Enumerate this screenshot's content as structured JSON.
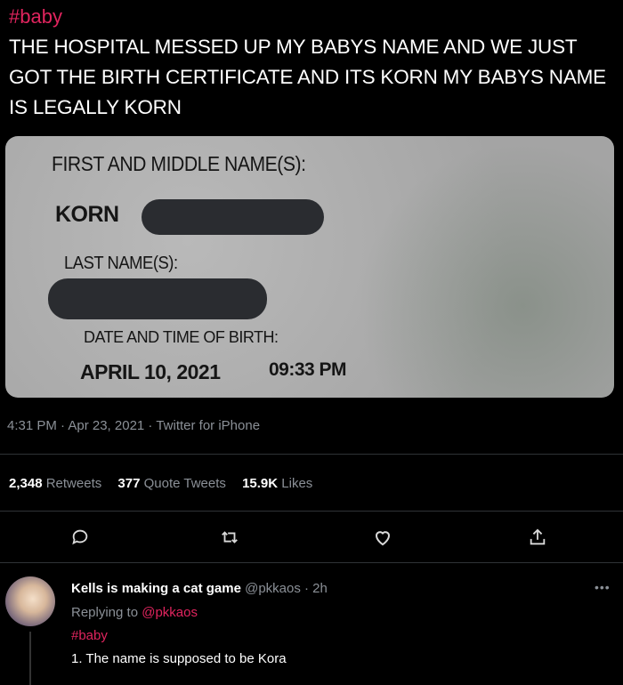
{
  "tweet": {
    "hashtag": "#baby",
    "text": "THE HOSPITAL MESSED UP MY BABYS NAME AND WE JUST GOT THE BIRTH CERTIFICATE AND ITS KORN MY BABYS NAME IS LEGALLY KORN",
    "timestamp": "4:31 PM · Apr 23, 2021 · Twitter for iPhone"
  },
  "certificate": {
    "first_middle_label": "FIRST AND MIDDLE NAME(S):",
    "first_name_value": "KORN",
    "last_name_label": "LAST NAME(S):",
    "dob_label": "DATE AND TIME OF BIRTH:",
    "dob_date": "APRIL 10, 2021",
    "dob_time": "09:33 PM"
  },
  "stats": {
    "retweets_count": "2,348",
    "retweets_label": "Retweets",
    "quotes_count": "377",
    "quotes_label": "Quote Tweets",
    "likes_count": "15.9K",
    "likes_label": "Likes"
  },
  "actions": {
    "icons": [
      "reply-icon",
      "retweet-icon",
      "like-icon",
      "share-icon"
    ]
  },
  "reply": {
    "name": "Kells is making a cat game",
    "handle": "@pkkaos · 2h",
    "replying_prefix": "Replying to",
    "replying_to": "@pkkaos",
    "hashtag": "#baby",
    "text": "1. The name is supposed to be Kora"
  },
  "colors": {
    "accent": "#e0245e",
    "background": "#000000",
    "muted": "#8b9097"
  }
}
